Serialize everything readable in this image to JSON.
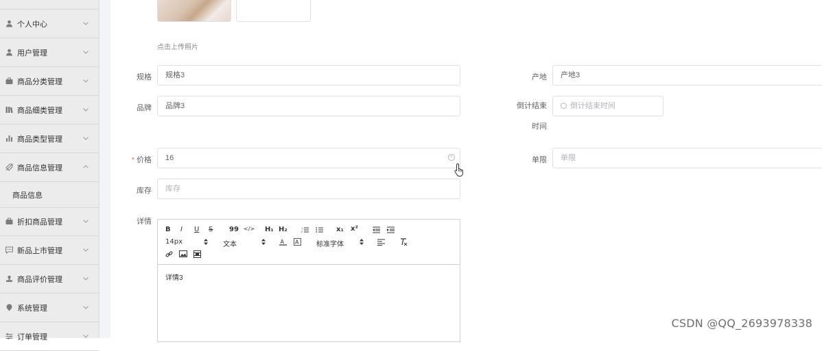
{
  "sidebar": {
    "items": [
      {
        "label": "个人中心",
        "icon": "person-icon",
        "expanded": false
      },
      {
        "label": "用户管理",
        "icon": "person-icon",
        "expanded": false
      },
      {
        "label": "商品分类管理",
        "icon": "briefcase-icon",
        "expanded": false
      },
      {
        "label": "商品细类管理",
        "icon": "library-icon",
        "expanded": false
      },
      {
        "label": "商品类型管理",
        "icon": "bar-chart-icon",
        "expanded": false
      },
      {
        "label": "商品信息管理",
        "icon": "discount-icon",
        "expanded": true
      },
      {
        "label": "折扣商品管理",
        "icon": "briefcase-icon",
        "expanded": false
      },
      {
        "label": "新品上市管理",
        "icon": "chat-icon",
        "expanded": false
      },
      {
        "label": "商品评价管理",
        "icon": "stamp-icon",
        "expanded": false
      },
      {
        "label": "系统管理",
        "icon": "location-icon",
        "expanded": false
      },
      {
        "label": "订单管理",
        "icon": "sliders-icon",
        "expanded": false
      }
    ],
    "submenu": {
      "label": "商品信息"
    }
  },
  "form": {
    "upload_hint": "点击上传照片",
    "spec": {
      "label": "规格",
      "value": "规格3"
    },
    "origin": {
      "label": "产地",
      "value": "产地3"
    },
    "brand": {
      "label": "品牌",
      "value": "品牌3"
    },
    "countdown": {
      "label": "倒计结束时间",
      "placeholder": "倒计结束时间"
    },
    "price": {
      "label": "价格",
      "value": "16",
      "required_mark": "*"
    },
    "limit": {
      "label": "单限",
      "placeholder": "单限"
    },
    "stock": {
      "label": "库存",
      "placeholder": "库存"
    },
    "detail": {
      "label": "详情",
      "content": "详情3"
    }
  },
  "editor_toolbar": {
    "bold": "B",
    "italic": "I",
    "underline": "U",
    "strike": "S",
    "blockquote": "99",
    "code": "</>",
    "h1": "H₁",
    "h2": "H₂",
    "subscript": "x₁",
    "superscript": "x²",
    "font_size": "14px",
    "text_type": "文本",
    "font_family": "标准字体"
  },
  "watermark": "CSDN @QQ_2693978338"
}
